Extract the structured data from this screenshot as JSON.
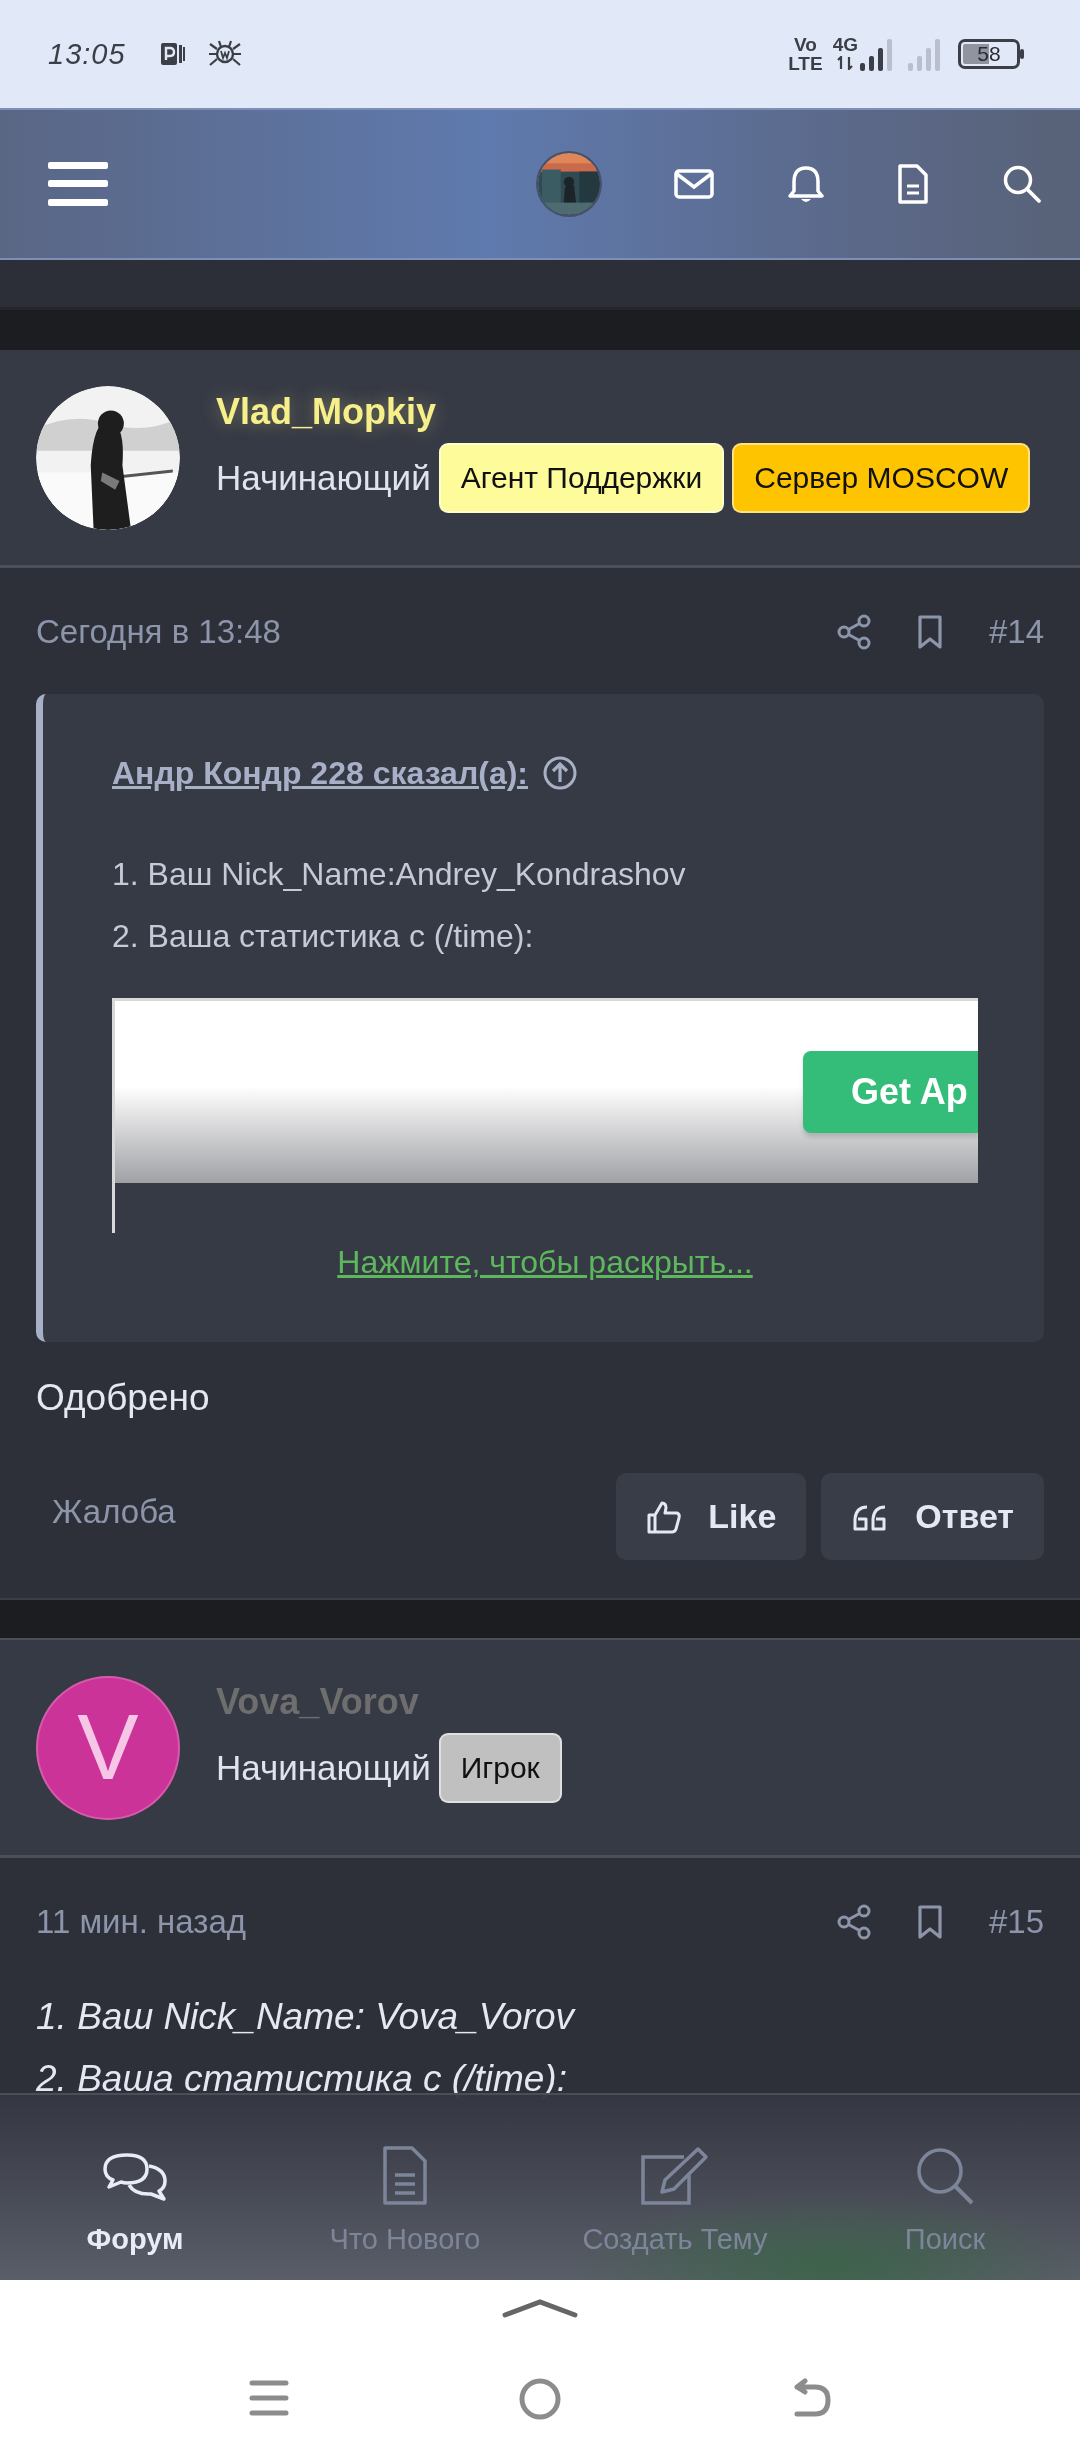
{
  "status_bar": {
    "time": "13:05",
    "network": [
      "Vo",
      "LTE"
    ],
    "data": "4G",
    "battery": "58"
  },
  "posts": [
    {
      "user": {
        "name": "Vlad_Mopkiy",
        "color": "#f7f08a",
        "glow": true
      },
      "role": "Начинающий",
      "badges": [
        {
          "label": "Агент Поддержки",
          "color": "#fdfb9a"
        },
        {
          "label": "Сервер MOSCOW",
          "color": "#ffc400"
        }
      ],
      "date": "Сегодня в 13:48",
      "number": "#14",
      "body": [
        {
          "kind": "quote",
          "author": "Андр Кондр 228 сказал(а):",
          "lines": [
            "1. Ваш Nick_Name:Andrey_Kondrashov",
            "2. Ваша статистика с (/time):"
          ],
          "attachment": {
            "button": "Get Ap"
          },
          "expand": "Нажмите, чтобы раскрыть..."
        },
        {
          "kind": "text",
          "text": "Одобрено"
        }
      ],
      "actions": {
        "report": "Жалоба",
        "like": "Like",
        "reply": "Ответ"
      }
    },
    {
      "user": {
        "name": "Vova_Vorov",
        "color": "#6e6e6e"
      },
      "avatar": {
        "kind": "letter",
        "letter": "V",
        "color": "#cc3399"
      },
      "role": "Начинающий",
      "badges": [
        {
          "label": "Игрок",
          "color": "#c0c0c0"
        }
      ],
      "date": "11 мин. назад",
      "number": "#15",
      "body": [
        {
          "kind": "italic",
          "text": "1. Ваш Nick_Name: Vova_Vorov"
        },
        {
          "kind": "italic",
          "text": "2. Ваша статистика с (/time):"
        }
      ]
    }
  ],
  "bottom_nav": {
    "items": [
      {
        "kind": "forum",
        "label": "Форум",
        "selected": true
      },
      {
        "kind": "new",
        "label": "Что Нового",
        "selected": false
      },
      {
        "kind": "create",
        "label": "Создать Тему",
        "selected": false
      },
      {
        "kind": "search",
        "label": "Поиск",
        "selected": false
      }
    ]
  }
}
